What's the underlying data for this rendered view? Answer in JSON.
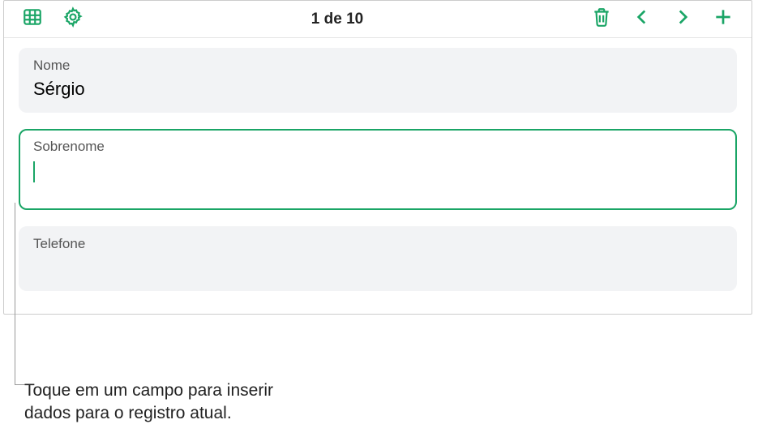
{
  "toolbar": {
    "counter": "1 de 10"
  },
  "fields": {
    "name": {
      "label": "Nome",
      "value": "Sérgio"
    },
    "surname": {
      "label": "Sobrenome",
      "value": ""
    },
    "phone": {
      "label": "Telefone",
      "value": ""
    }
  },
  "callout": "Toque em um campo para inserir dados para o registro atual."
}
